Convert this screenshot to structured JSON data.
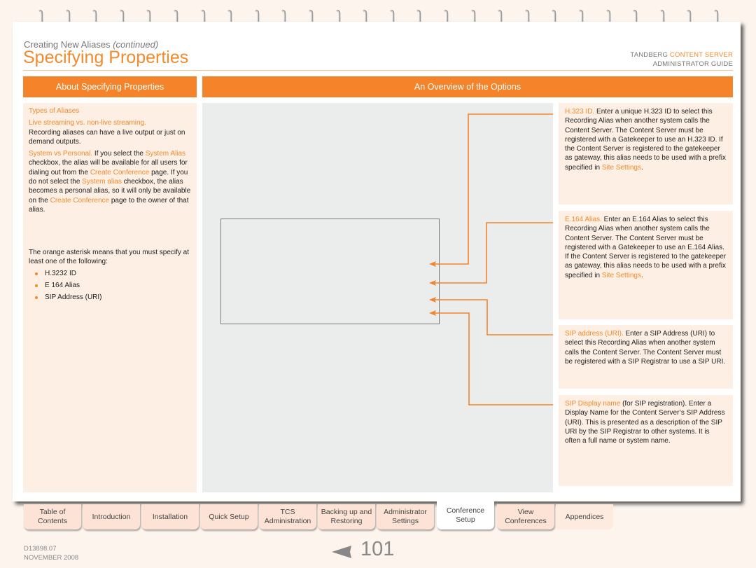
{
  "header": {
    "section": "Creating New Aliases",
    "section_suffix": "(continued)",
    "title": "Specifying Properties",
    "brand_left": "TANDBERG ",
    "brand_accent": "CONTENT SERVER",
    "guide": "ADMINISTRATOR GUIDE"
  },
  "left": {
    "heading": "About Specifying Properties",
    "types_title": "Types of Aliases",
    "live_title": "Live streaming vs. non-live streaming.",
    "live_body": "Recording aliases can have a live output or just on demand outputs.",
    "sp_title": "System vs Personal.",
    "sp_1": " If you select the ",
    "sp_link1": "System Alias",
    "sp_2": " checkbox, the alias will be available for all users for dialing out from the ",
    "sp_link2": "Create Conference",
    "sp_3": " page. If you do not select the ",
    "sp_link3": "System alias",
    "sp_4": " checkbox, the alias becomes a personal alias, so it will only be available on the ",
    "sp_link4": "Create Conference",
    "sp_5": " page to the owner of that alias.",
    "asterisk_note": "The orange asterisk means that you must specify at least one of the following:",
    "bullets": [
      "H.3232 ID",
      "E 164 Alias",
      "SIP Address (URI)"
    ]
  },
  "main": {
    "heading": "An Overview of the Options",
    "options": [
      {
        "title": "H.323 ID.",
        "body": " Enter a unique H.323 ID to select this Recording Alias when another system calls the Content Server. The Content Server must be registered with a Gatekeeper to use an H.323 ID. If the Content Server is registered to the gatekeeper as gateway, this alias needs to be used with a prefix specified in ",
        "link": "Site Settings",
        "end": "."
      },
      {
        "title": "E.164 Alias.",
        "body": " Enter an E.164 Alias to select this Recording Alias when another system calls the Content Server. The Content Server must be registered with a Gatekeeper to use an E.164 Alias. If the Content Server is registered to the gatekeeper as gateway, this alias needs to be used with a prefix specified in ",
        "link": "Site Settings",
        "end": "."
      },
      {
        "title": "SIP address (URI).",
        "body": " Enter a SIP Address (URI) to select this Recording Alias when another system calls the Content Server. The Content Server must be registered with a SIP Registrar to use a SIP URI.",
        "link": "",
        "end": ""
      },
      {
        "title": "SIP Display name",
        "body": " (for SIP registration). Enter a Display Name for the Content Server’s SIP Address (URI). This is presented as a description of the SIP URI by the SIP Registrar to other systems. It is often a full name or system name.",
        "link": "",
        "end": ""
      }
    ]
  },
  "nav": {
    "tabs": [
      {
        "label1": "Table of",
        "label2": "Contents"
      },
      {
        "label1": "Introduction",
        "label2": ""
      },
      {
        "label1": "Installation",
        "label2": ""
      },
      {
        "label1": "Quick Setup",
        "label2": ""
      },
      {
        "label1": "TCS",
        "label2": "Administration"
      },
      {
        "label1": "Backing up and",
        "label2": "Restoring"
      },
      {
        "label1": "Administrator",
        "label2": "Settings"
      },
      {
        "label1": "Conference",
        "label2": "Setup"
      },
      {
        "label1": "View",
        "label2": "Conferences"
      },
      {
        "label1": "Appendices",
        "label2": ""
      }
    ],
    "active_index": 7
  },
  "footer": {
    "doc_id": "D13898.07",
    "date": "NOVEMBER 2008",
    "page_number": "101",
    "prev_icon": "previous-page-arrow-icon"
  },
  "colors": {
    "accent": "#f4832a",
    "panel": "#fdefe3",
    "diagram_bg": "#ebecec"
  }
}
